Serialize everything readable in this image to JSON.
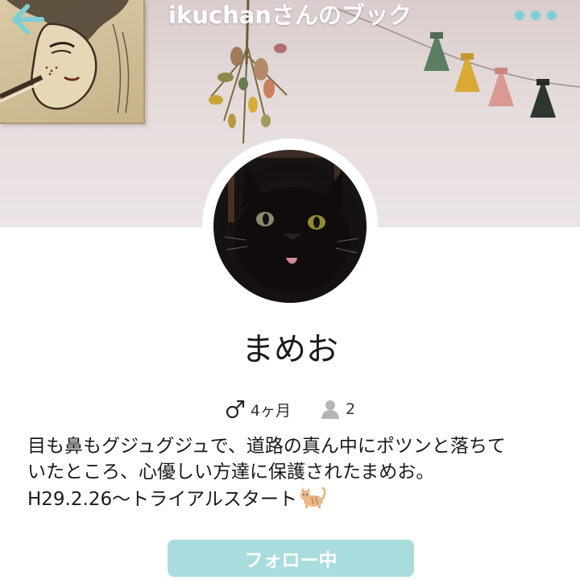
{
  "header": {
    "title": "ikuchanさんのブック",
    "back_icon": "arrow-left-icon",
    "more_icon": "more-dots-icon",
    "accent_color": "#7ecfd3"
  },
  "profile": {
    "name": "まめお",
    "gender_icon": "male-icon",
    "age": "4ヶ月",
    "followers_icon": "person-icon",
    "followers_count": "2",
    "bio_lines": [
      "目も鼻もグジュグジュで、道路の真ん中にポツンと落ちて",
      "いたところ、心優しい方達に保護されたまめお。",
      "H29.2.26〜トライアルスタート"
    ],
    "bio_emoji": "cat-emoji"
  },
  "follow_button": {
    "label": "フォロー中",
    "color": "#a9dcdd"
  }
}
